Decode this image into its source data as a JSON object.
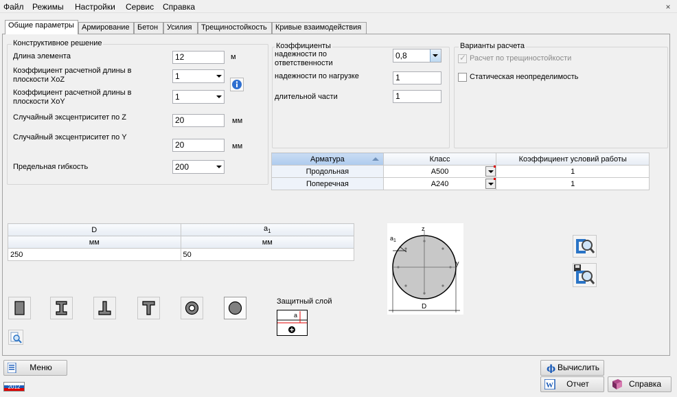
{
  "menu": [
    "Файл",
    "Режимы",
    "Настройки",
    "Сервис",
    "Справка"
  ],
  "window_close": "×",
  "tabs": [
    "Общие параметры",
    "Армирование",
    "Бетон",
    "Усилия",
    "Трещиностойкость",
    "Кривые взаимодействия"
  ],
  "design": {
    "title": "Конструктивное решение",
    "length_label": "Длина элемента",
    "length_value": "12",
    "length_unit": "м",
    "xoz_label": "Коэффициент расчетной длины в плоскости XoZ",
    "xoz_value": "1",
    "xoy_label": "Коэффициент расчетной длины в плоскости XoY",
    "xoy_value": "1",
    "ecc_z_label": "Случайный эксцентриситет по Z",
    "ecc_z_value": "20",
    "ecc_z_unit": "мм",
    "ecc_y_label": "Случайный эксцентриситет по Y",
    "ecc_y_value": "20",
    "ecc_y_unit": "мм",
    "slender_label": "Предельная гибкость",
    "slender_value": "200"
  },
  "coefs": {
    "title": "Коэффициенты",
    "resp_label": "надежности по ответственности",
    "resp_value": "0,8",
    "load_label": "надежности по нагрузке",
    "load_value": "1",
    "long_label": "длительной части",
    "long_value": "1"
  },
  "variants": {
    "title": "Варианты расчета",
    "crack_label": "Расчет по трещиностойкости",
    "crack_checked": true,
    "static_label": "Статическая неопределимость",
    "static_checked": false
  },
  "rebar_table": {
    "headers": [
      "Арматура",
      "Класс",
      "Коэффициент условий работы"
    ],
    "rows": [
      {
        "name": "Продольная",
        "class": "A500",
        "coef": "1"
      },
      {
        "name": "Поперечная",
        "class": "A240",
        "coef": "1"
      }
    ]
  },
  "section_table": {
    "headers": [
      "D",
      "a1"
    ],
    "units": [
      "мм",
      "мм"
    ],
    "values": [
      "250",
      "50"
    ]
  },
  "shapes": [
    "rectangle",
    "i-beam",
    "inverted-tee",
    "tee",
    "ring",
    "circle"
  ],
  "cover_label": "Защитный слой",
  "cover_glyph": "a",
  "diagram": {
    "z_label": "z",
    "y_label": "y",
    "a1_label": "a1",
    "d_label": "D"
  },
  "bottom": {
    "menu_label": "Меню",
    "calc_label": "Вычислить",
    "report_label": "Отчет",
    "help_label": "Справка",
    "year_badge": "2012"
  },
  "colors": {
    "accent_blue": "#1c5cb8",
    "selected_header": "#b8d0ef",
    "required_mark": "#e00000"
  }
}
